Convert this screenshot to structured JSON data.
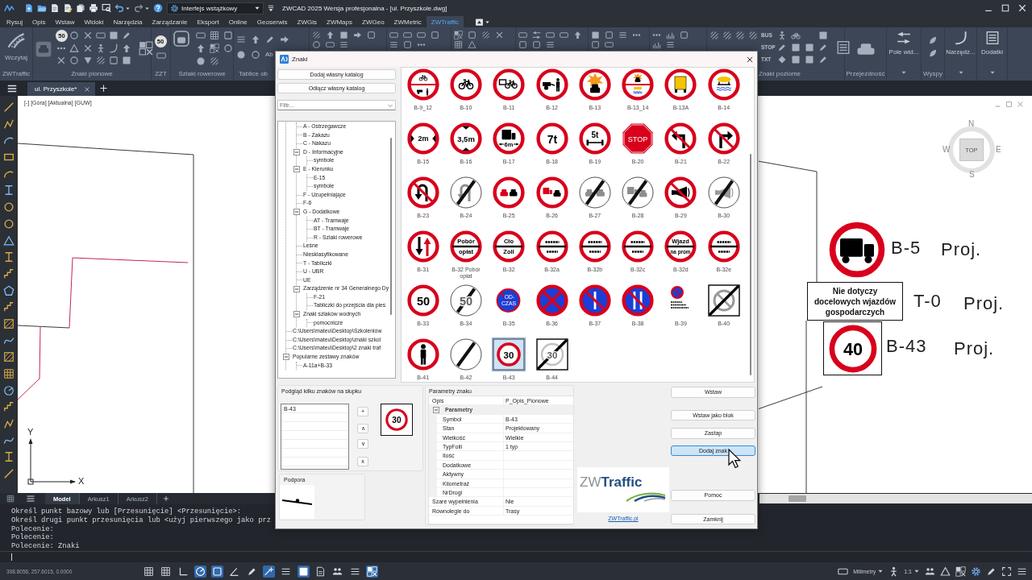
{
  "titlebar": {
    "workspace": "Interfejs wstążkowy",
    "title": "ZWCAD 2025 Wersja profesjonalna - [ul. Przyszkole.dwg]"
  },
  "menu": [
    {
      "label": "Rysuj",
      "selected": false
    },
    {
      "label": "Opis",
      "selected": false
    },
    {
      "label": "Wstaw",
      "selected": false
    },
    {
      "label": "Widoki",
      "selected": false
    },
    {
      "label": "Narzędzia",
      "selected": false
    },
    {
      "label": "Zarządzanie",
      "selected": false
    },
    {
      "label": "Eksport",
      "selected": false
    },
    {
      "label": "Online",
      "selected": false
    },
    {
      "label": "Geoserwis",
      "selected": false
    },
    {
      "label": "ZWGis",
      "selected": false
    },
    {
      "label": "ZWMaps",
      "selected": false
    },
    {
      "label": "ZWGeo",
      "selected": false
    },
    {
      "label": "ZWMetric",
      "selected": false
    },
    {
      "label": "ZWTraffic",
      "selected": true
    }
  ],
  "ribbon": {
    "panels": [
      {
        "label": "ZWTraffic",
        "buttons": [
          "Wczytaj"
        ]
      },
      {
        "label": "Znaki pionowe",
        "buttons": [
          "50"
        ]
      },
      {
        "label": "ZZT",
        "buttons": [
          "50"
        ]
      },
      {
        "label": "Szlaki rowerowe"
      },
      {
        "label": "Tablice ob",
        "buttons": [
          "Ab"
        ]
      },
      {
        "label": "Znaki poziome",
        "buttons": [
          "BUS",
          "STOP",
          "TXT"
        ]
      },
      {
        "label": "Przejezdność"
      },
      {
        "buttons": [
          "Pole wid..."
        ]
      },
      {
        "label": "Wyspy"
      },
      {
        "buttons": [
          "Narzędz..."
        ]
      },
      {
        "buttons": [
          "Dodatki"
        ]
      }
    ]
  },
  "document_tabs": [
    {
      "label": "ul. Przyszkole*",
      "selected": true
    }
  ],
  "viewport": {
    "label": "[-] [Góra] [Aktualna] [GUW]",
    "viewcube": {
      "face": "TOP",
      "north": "N",
      "south": "S",
      "west": "W",
      "east": "E"
    },
    "ucs": {
      "x": "X",
      "y": "Y"
    }
  },
  "drawing": {
    "signs": [
      {
        "kind": "truck",
        "code": "B-5",
        "status": "Proj."
      },
      {
        "kind": "plate",
        "lines": [
          "Nie dotyczy",
          "docelowych wjazdów",
          "gospodarczych"
        ],
        "code": "T-0",
        "status": "Proj."
      },
      {
        "kind": "number",
        "legend": [
          "40"
        ],
        "code": "B-43",
        "status": "Proj."
      }
    ]
  },
  "layout_tabs": [
    {
      "label": "Model",
      "selected": true
    },
    {
      "label": "Arkusz1",
      "selected": false
    },
    {
      "label": "Arkusz2",
      "selected": false
    }
  ],
  "command_line": {
    "history": [
      "Określ punkt bazowy lub [Przesunięcie] <Przesunięcie>:",
      "Określ drugi punkt przesunięcia lub <użyj pierwszego jako prz",
      "Polecenie:",
      "Polecenie:",
      "Polecenie: Znaki"
    ]
  },
  "status_bar": {
    "coordinates": "398.8056, 257.6015, 0.0000",
    "toggles": [
      {
        "on": false
      },
      {
        "on": false
      },
      {
        "on": false
      },
      {
        "on": true
      },
      {
        "on": true
      },
      {
        "on": false
      },
      {
        "on": false
      },
      {
        "on": true
      },
      {
        "on": false
      },
      {
        "on": true
      },
      {
        "on": false
      },
      {
        "on": false
      },
      {
        "on": false
      },
      {
        "on": true
      }
    ],
    "units": "Milimetry",
    "scale": "1:1"
  },
  "dialog": {
    "title": "Znaki",
    "catalog_buttons": [
      "Dodaj własny katalog",
      "Odłącz własny katalog"
    ],
    "filter": {
      "placeholder": "Filtr..."
    },
    "tree": [
      {
        "children": [
          {
            "label": "A - Ostrzegawcze"
          },
          {
            "label": "B - Zakazu"
          },
          {
            "label": "C - Nakazu"
          },
          {
            "label": "D - Informacyjne",
            "expanded": true,
            "children": [
              {
                "label": "symbole"
              }
            ]
          },
          {
            "label": "E - Kierunku",
            "expanded": true,
            "children": [
              {
                "label": "E-15"
              },
              {
                "label": "symbole"
              }
            ]
          },
          {
            "label": "F - Uzupełniające"
          },
          {
            "label": "F-6"
          },
          {
            "label": "G - Dodatkowe",
            "expanded": true,
            "children": [
              {
                "label": "AT - Tramwaje"
              },
              {
                "label": "BT - Tramwaje"
              },
              {
                "label": "R - Szlaki rowerowe"
              }
            ]
          },
          {
            "label": "Leśne"
          },
          {
            "label": "Niesklasyfikowane"
          },
          {
            "label": "T - Tabliczki"
          },
          {
            "label": "U - UBR"
          },
          {
            "label": "UE"
          },
          {
            "label": "Zarządzenie nr 34 Generalnego Dy",
            "expanded": true,
            "children": [
              {
                "label": "F-21"
              },
              {
                "label": "Tabliczki do przejścia dla pies"
              }
            ]
          },
          {
            "label": "Znaki szlaków wodnych",
            "expanded": true,
            "children": [
              {
                "label": "pomocnicze"
              }
            ]
          }
        ]
      },
      {
        "label": "C:\\Users\\mateu\\Desktop\\Szkoleniów"
      },
      {
        "label": "C:\\Users\\mateu\\Desktop\\znaki szkol"
      },
      {
        "label": "C:\\Users\\mateu\\Desktop\\2 znaki traf"
      },
      {
        "label": "Popularne zestawy znaków",
        "expanded": true,
        "children": [
          {
            "label": "A-11a+B-33"
          }
        ]
      }
    ],
    "signs": [
      {
        "label": "B-9_12",
        "kind": "split-bike",
        "selected": false
      },
      {
        "label": "B-10",
        "kind": "moped",
        "selected": false
      },
      {
        "label": "B-11",
        "kind": "cargo-bike",
        "selected": false
      },
      {
        "label": "B-12",
        "kind": "handcart",
        "selected": false
      },
      {
        "label": "B-13",
        "kind": "explosive",
        "selected": false
      },
      {
        "label": "B-13_14",
        "kind": "split-explosive",
        "selected": false
      },
      {
        "label": "B-13A",
        "kind": "yellow-truck",
        "selected": false
      },
      {
        "label": "B-14",
        "kind": "water-tank",
        "selected": false
      },
      {
        "label": "B-15",
        "kind": "width",
        "legend": [
          "2m"
        ],
        "selected": false
      },
      {
        "label": "B-16",
        "kind": "height",
        "legend": [
          "3,5m"
        ],
        "selected": false
      },
      {
        "label": "B-17",
        "kind": "length",
        "legend": [
          "6m"
        ],
        "selected": false
      },
      {
        "label": "B-18",
        "kind": "weight",
        "legend": [
          "7t"
        ],
        "selected": false
      },
      {
        "label": "B-19",
        "kind": "axle",
        "legend": [
          "5t"
        ],
        "selected": false
      },
      {
        "label": "B-20",
        "kind": "stop",
        "legend": [
          "STOP"
        ],
        "selected": false
      },
      {
        "label": "B-21",
        "kind": "no-left-turn",
        "selected": false
      },
      {
        "label": "B-22",
        "kind": "no-right-turn",
        "selected": false
      },
      {
        "label": "B-23",
        "kind": "no-u-turn",
        "selected": false
      },
      {
        "label": "B-24",
        "kind": "end-u-turn",
        "selected": false
      },
      {
        "label": "B-25",
        "kind": "no-overtaking",
        "selected": false
      },
      {
        "label": "B-26",
        "kind": "no-overtaking-trucks",
        "selected": false
      },
      {
        "label": "B-27",
        "kind": "end-overtaking",
        "selected": false
      },
      {
        "label": "B-28",
        "kind": "end-overtaking-trucks",
        "selected": false
      },
      {
        "label": "B-29",
        "kind": "no-horn",
        "selected": false
      },
      {
        "label": "B-30",
        "kind": "end-horn",
        "selected": false
      },
      {
        "label": "B-31",
        "kind": "priority",
        "selected": false
      },
      {
        "label": "B-32 Pobór opłat",
        "kind": "bar",
        "legend": [
          "Pobór",
          "opłat"
        ],
        "selected": false
      },
      {
        "label": "B-32",
        "kind": "bar",
        "legend": [
          "Cło",
          "Zoll"
        ],
        "selected": false
      },
      {
        "label": "B-32a",
        "kind": "bar-fine",
        "selected": false
      },
      {
        "label": "B-32b",
        "kind": "bar-fine",
        "selected": false
      },
      {
        "label": "B-32c",
        "kind": "bar-fine",
        "selected": false
      },
      {
        "label": "B-32d",
        "kind": "bar",
        "legend": [
          "Wjazd",
          "na prom"
        ],
        "selected": false
      },
      {
        "label": "B-32e",
        "kind": "bar-fine",
        "selected": false
      },
      {
        "label": "B-33",
        "kind": "number",
        "legend": [
          "50"
        ],
        "selected": false
      },
      {
        "label": "B-34",
        "kind": "end-number",
        "legend": [
          "50"
        ],
        "selected": false
      },
      {
        "label": "B-35",
        "kind": "time",
        "legend": [
          "OD-",
          "CZAS"
        ],
        "selected": false
      },
      {
        "label": "B-36",
        "kind": "no-stopping",
        "selected": false
      },
      {
        "label": "B-37",
        "kind": "no-parking-odd",
        "selected": false
      },
      {
        "label": "B-38",
        "kind": "no-parking-even",
        "selected": false
      },
      {
        "label": "B-39",
        "kind": "zone-no-parking",
        "selected": false
      },
      {
        "label": "B-40",
        "kind": "end-zone",
        "selected": false
      },
      {
        "label": "B-41",
        "kind": "no-pedestrians",
        "selected": false
      },
      {
        "label": "B-42",
        "kind": "end",
        "selected": false
      },
      {
        "label": "B-43",
        "kind": "zone",
        "legend": [
          "30"
        ],
        "selected": true
      },
      {
        "label": "B-44",
        "kind": "end-zone-number",
        "legend": [
          "30"
        ],
        "selected": false
      }
    ],
    "preview": {
      "title": "Podgląd kilku znaków na słupku",
      "items": [
        "B-43"
      ],
      "buttons": [
        "+",
        "∧",
        "∨",
        "x"
      ],
      "sign": {
        "kind": "number",
        "legend": [
          "30"
        ]
      }
    },
    "support": {
      "title": "Podpora"
    },
    "parameters": {
      "title": "Parametry znaku",
      "rows": [
        {
          "name": "Opis",
          "value": "P_Opis_Pionowe"
        },
        {
          "kind": "section",
          "name": "Parametry",
          "expanded": true,
          "children": [
            {
              "name": "Symbol",
              "value": "B-43"
            },
            {
              "name": "Stan",
              "value": "Projektowany"
            },
            {
              "name": "Wielkość",
              "value": "Wielkie"
            },
            {
              "name": "TypFolii",
              "value": "1 typ"
            },
            {
              "name": "Ilość"
            },
            {
              "name": "Dodatkowe"
            },
            {
              "name": "Aktywny"
            },
            {
              "name": "Kilometraż"
            },
            {
              "name": "NrDrogi"
            }
          ]
        },
        {
          "name": "Szare wypełnienia",
          "value": "Nie"
        },
        {
          "name": "Równolegle do",
          "value": "Trasy"
        }
      ]
    },
    "logo": "ZW**Traffic**",
    "link": "ZWTraffic.pl",
    "buttons": [
      {
        "label": "Wstaw",
        "hovered": false
      },
      {
        "label": "Wstaw jako blok",
        "hovered": false
      },
      {
        "label": "Zastap",
        "hovered": false
      },
      {
        "label": "Dodaj znak",
        "hovered": true
      },
      {
        "label": "Pomoc",
        "hovered": false
      },
      {
        "label": "Zamknij",
        "hovered": false
      }
    ]
  }
}
